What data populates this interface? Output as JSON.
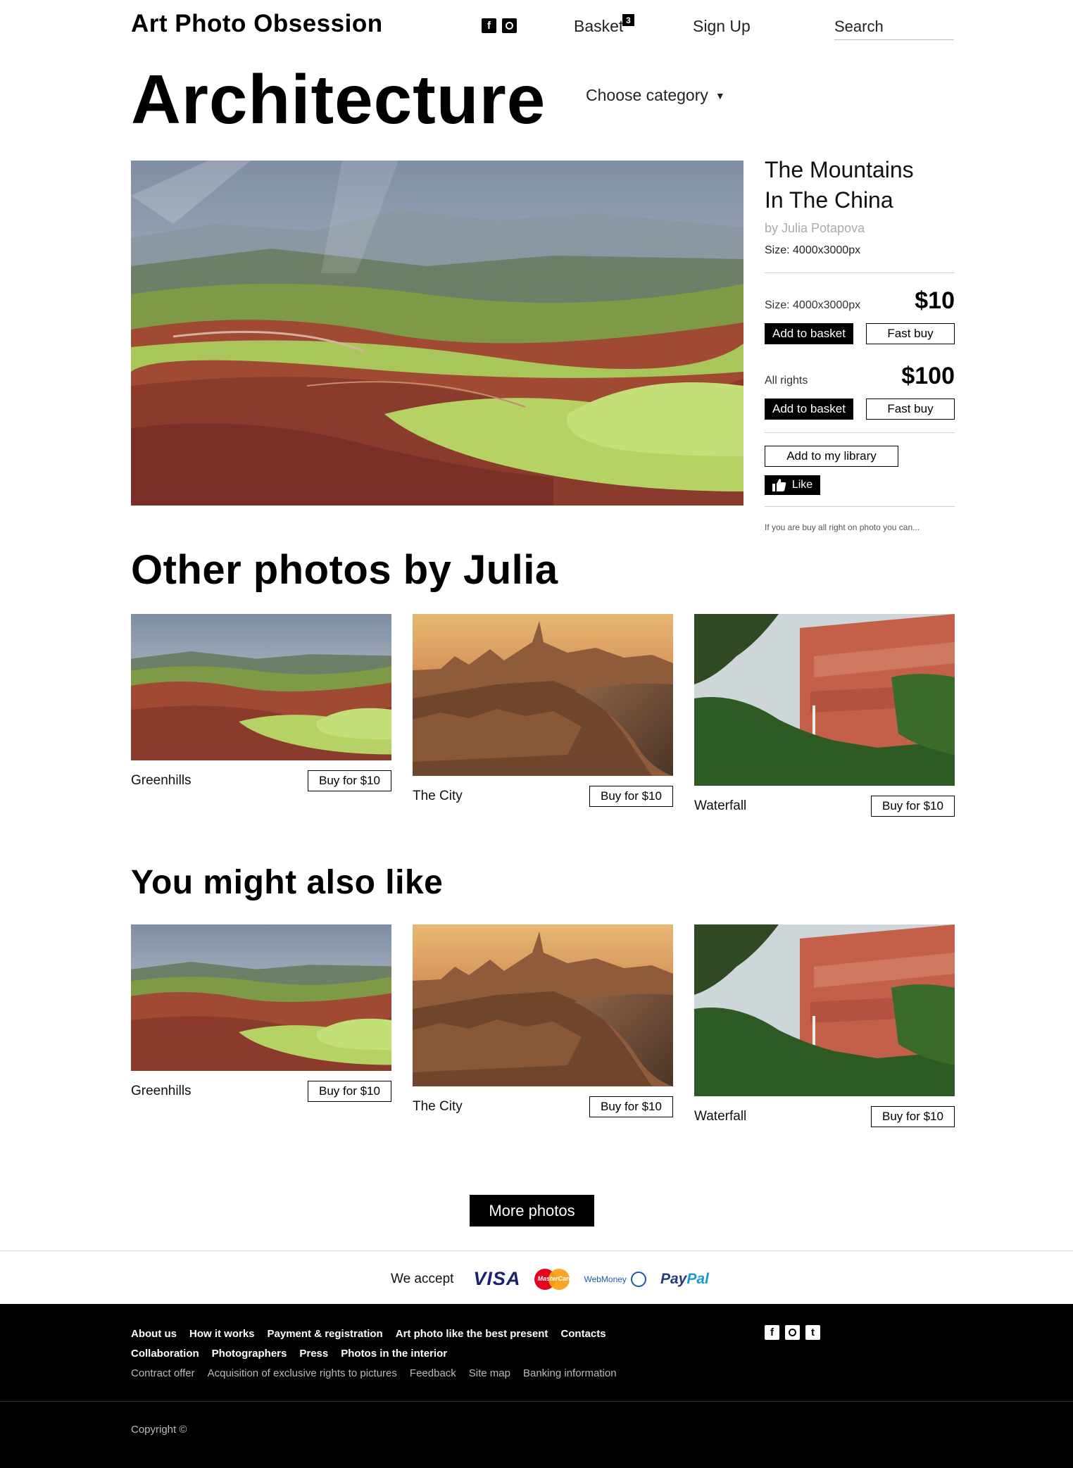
{
  "header": {
    "logo": "Art Photo Obsession",
    "social": [
      {
        "icon": "facebook-icon",
        "glyph": "f"
      },
      {
        "icon": "instagram-icon"
      }
    ],
    "basket_label": "Basket",
    "basket_count": "3",
    "signup_label": "Sign Up",
    "search_placeholder": "Search"
  },
  "page": {
    "title": "Architecture",
    "category_label": "Choose category",
    "caret": "▼"
  },
  "photo": {
    "title_line1": "The Mountains",
    "title_line2": "In The China",
    "author": "by Julia Potapova",
    "size": "Size: 4000x3000px",
    "options": [
      {
        "label": "Size: 4000x3000px",
        "price": "$10",
        "add_label": "Add to basket",
        "fast_label": "Fast buy"
      },
      {
        "label": "All rights",
        "price": "$100",
        "add_label": "Add to basket",
        "fast_label": "Fast buy"
      }
    ],
    "library_label": "Add to my library",
    "like_label": "Like",
    "note": "If you are buy all right on photo you can..."
  },
  "other": {
    "title": "Other photos by Julia",
    "cards": [
      {
        "name": "Greenhills",
        "buy": "Buy for $10"
      },
      {
        "name": "The City",
        "buy": "Buy for $10"
      },
      {
        "name": "Waterfall",
        "buy": "Buy for $10"
      }
    ]
  },
  "also": {
    "title": "You might also like",
    "cards": [
      {
        "name": "Greenhills",
        "buy": "Buy for $10"
      },
      {
        "name": "The City",
        "buy": "Buy for $10"
      },
      {
        "name": "Waterfall",
        "buy": "Buy for $10"
      }
    ]
  },
  "more_label": "More photos",
  "payments": {
    "label": "We accept",
    "visa": "VISA",
    "mastercard": "MasterCard",
    "webmoney": "WebMoney",
    "paypal_a": "Pay",
    "paypal_b": "Pal"
  },
  "footer": {
    "row1": [
      "About us",
      "How it works",
      "Payment & registration",
      "Art photo like the best present",
      "Contacts"
    ],
    "row2": [
      "Collaboration",
      "Photographers",
      "Press",
      "Photos in the interior"
    ],
    "row3": [
      "Contract offer",
      "Acquisition of exclusive rights to pictures",
      "Feedback",
      "Site map",
      "Banking information"
    ],
    "social": [
      {
        "icon": "facebook-icon",
        "glyph": "f"
      },
      {
        "icon": "instagram-icon"
      },
      {
        "icon": "tumblr-icon",
        "glyph": "t"
      }
    ],
    "copyright": "Copyright ©"
  }
}
